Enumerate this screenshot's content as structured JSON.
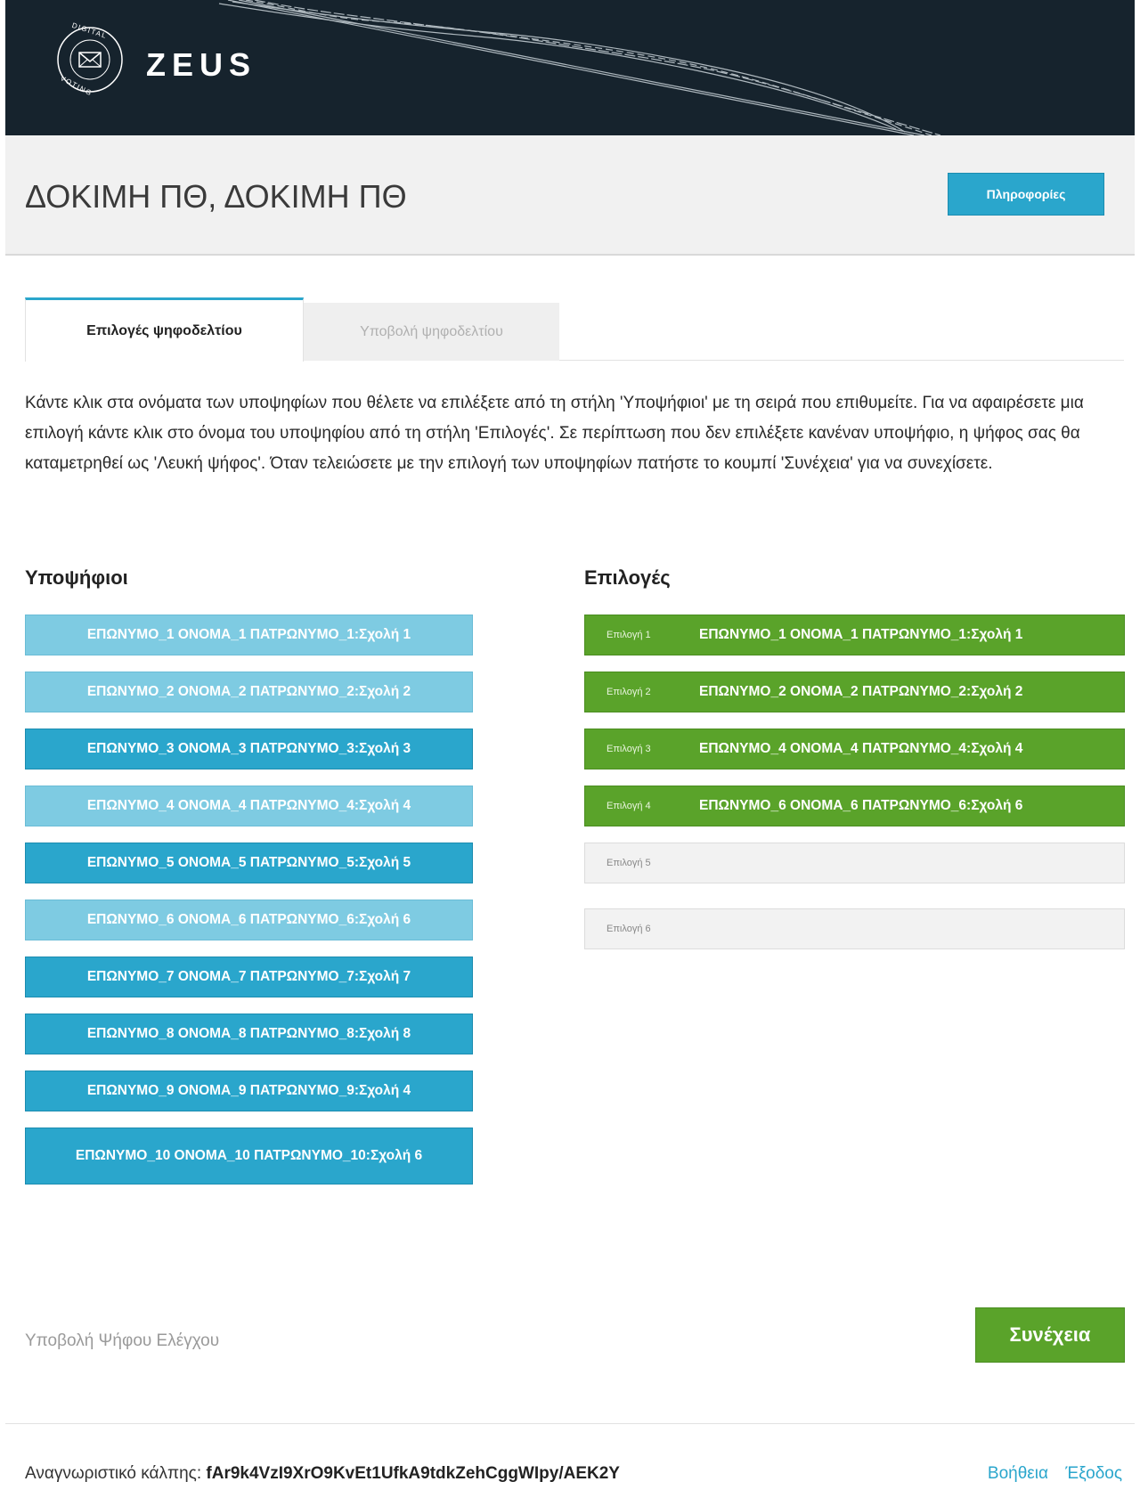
{
  "header": {
    "logo_text": "ZEUS",
    "badge_top": "DIGITAL",
    "badge_bottom": "VOTING"
  },
  "titlebar": {
    "title": "ΔΟΚΙΜΗ ΠΘ, ΔΟΚΙΜΗ ΠΘ",
    "info_button": "Πληροφορίες"
  },
  "tabs": [
    {
      "label": "Επιλογές ψηφοδελτίου",
      "active": true
    },
    {
      "label": "Υποβολή ψηφοδελτίου",
      "active": false
    }
  ],
  "instructions": "Κάντε κλικ στα ονόματα των υποψηφίων που θέλετε να επιλέξετε από τη στήλη 'Υποψήφιοι' με τη σειρά που επιθυμείτε. Για να αφαιρέσετε μια επιλογή κάντε κλικ στο όνομα του υποψηφίου από τη στήλη 'Επιλογές'. Σε περίπτωση που δεν επιλέξετε κανέναν υποψήφιο, η ψήφος σας θα καταμετρηθεί ως 'Λευκή ψήφος'. Όταν τελειώσετε με την επιλογή των υποψηφίων πατήστε το κουμπί 'Συνέχεια' για να συνεχίσετε.",
  "candidates_title": "Υποψήφιοι",
  "choices_title": "Επιλογές",
  "candidates": [
    {
      "label": "ΕΠΩΝΥΜΟ_1 ΟΝΟΜΑ_1 ΠΑΤΡΩΝΥΜΟ_1:Σχολή 1",
      "selected": true
    },
    {
      "label": "ΕΠΩΝΥΜΟ_2 ΟΝΟΜΑ_2 ΠΑΤΡΩΝΥΜΟ_2:Σχολή 2",
      "selected": true
    },
    {
      "label": "ΕΠΩΝΥΜΟ_3 ΟΝΟΜΑ_3 ΠΑΤΡΩΝΥΜΟ_3:Σχολή 3",
      "selected": false
    },
    {
      "label": "ΕΠΩΝΥΜΟ_4 ΟΝΟΜΑ_4 ΠΑΤΡΩΝΥΜΟ_4:Σχολή 4",
      "selected": true
    },
    {
      "label": "ΕΠΩΝΥΜΟ_5 ΟΝΟΜΑ_5 ΠΑΤΡΩΝΥΜΟ_5:Σχολή 5",
      "selected": false
    },
    {
      "label": "ΕΠΩΝΥΜΟ_6 ΟΝΟΜΑ_6 ΠΑΤΡΩΝΥΜΟ_6:Σχολή 6",
      "selected": true
    },
    {
      "label": "ΕΠΩΝΥΜΟ_7 ΟΝΟΜΑ_7 ΠΑΤΡΩΝΥΜΟ_7:Σχολή 7",
      "selected": false
    },
    {
      "label": "ΕΠΩΝΥΜΟ_8 ΟΝΟΜΑ_8 ΠΑΤΡΩΝΥΜΟ_8:Σχολή 8",
      "selected": false
    },
    {
      "label": "ΕΠΩΝΥΜΟ_9 ΟΝΟΜΑ_9 ΠΑΤΡΩΝΥΜΟ_9:Σχολή 4",
      "selected": false
    },
    {
      "label": "ΕΠΩΝΥΜΟ_10 ΟΝΟΜΑ_10 ΠΑΤΡΩΝΥΜΟ_10:Σχολή 6",
      "selected": false
    }
  ],
  "choices": [
    {
      "slot": "Επιλογή 1",
      "candidate": "ΕΠΩΝΥΜΟ_1 ΟΝΟΜΑ_1 ΠΑΤΡΩΝΥΜΟ_1:Σχολή 1"
    },
    {
      "slot": "Επιλογή 2",
      "candidate": "ΕΠΩΝΥΜΟ_2 ΟΝΟΜΑ_2 ΠΑΤΡΩΝΥΜΟ_2:Σχολή 2"
    },
    {
      "slot": "Επιλογή 3",
      "candidate": "ΕΠΩΝΥΜΟ_4 ΟΝΟΜΑ_4 ΠΑΤΡΩΝΥΜΟ_4:Σχολή 4"
    },
    {
      "slot": "Επιλογή 4",
      "candidate": "ΕΠΩΝΥΜΟ_6 ΟΝΟΜΑ_6 ΠΑΤΡΩΝΥΜΟ_6:Σχολή 6"
    },
    {
      "slot": "Επιλογή 5",
      "candidate": ""
    },
    {
      "slot": "Επιλογή 6",
      "candidate": ""
    }
  ],
  "actions": {
    "audit_link": "Υποβολή Ψήφου Ελέγχου",
    "continue_button": "Συνέχεια"
  },
  "footer": {
    "voter_id_label": "Αναγνωριστικό κάλπης:",
    "voter_id_value": "fAr9k4VzI9XrO9KvEt1UfkA9tdkZehCggWIpy/AEK2Y",
    "help_link": "Βοήθεια",
    "logout_link": "Έξοδος"
  },
  "colors": {
    "header_bg": "#16232d",
    "accent_blue": "#2aa6cc",
    "selected_blue": "#7ecbe2",
    "choice_green": "#5aa32a"
  }
}
